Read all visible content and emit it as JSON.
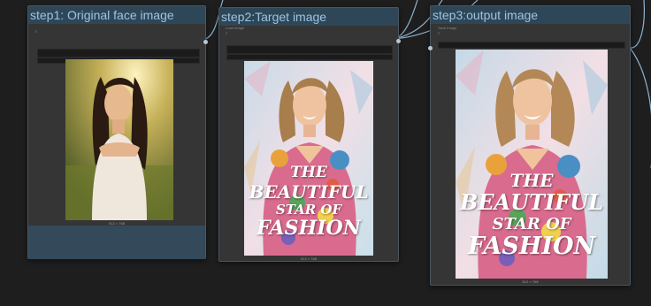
{
  "nodes": {
    "step1": {
      "title": "step1: Original face image",
      "widget_label": "≡",
      "image_caption": "512 × 768"
    },
    "step2": {
      "title": "step2:Target image",
      "widget_label": "Load Image",
      "widget_sub": "≡",
      "image_caption": "512 × 768",
      "poster_line1": "THE",
      "poster_line2": "BEAUTIFUL",
      "poster_line3": "STAR OF",
      "poster_line4": "FASHION"
    },
    "step3": {
      "title": "step3:output image",
      "widget_label": "Save Image",
      "widget_sub": "≡",
      "image_caption": "512 × 768",
      "poster_line1": "THE",
      "poster_line2": "BEAUTIFUL",
      "poster_line3": "STAR OF",
      "poster_line4": "FASHION"
    }
  },
  "colors": {
    "canvas": "#1e1e1e",
    "node_body": "#353535",
    "title_bar": "#2e4758",
    "title_text": "#9ec3e0",
    "wire": "#8fb4d0"
  }
}
